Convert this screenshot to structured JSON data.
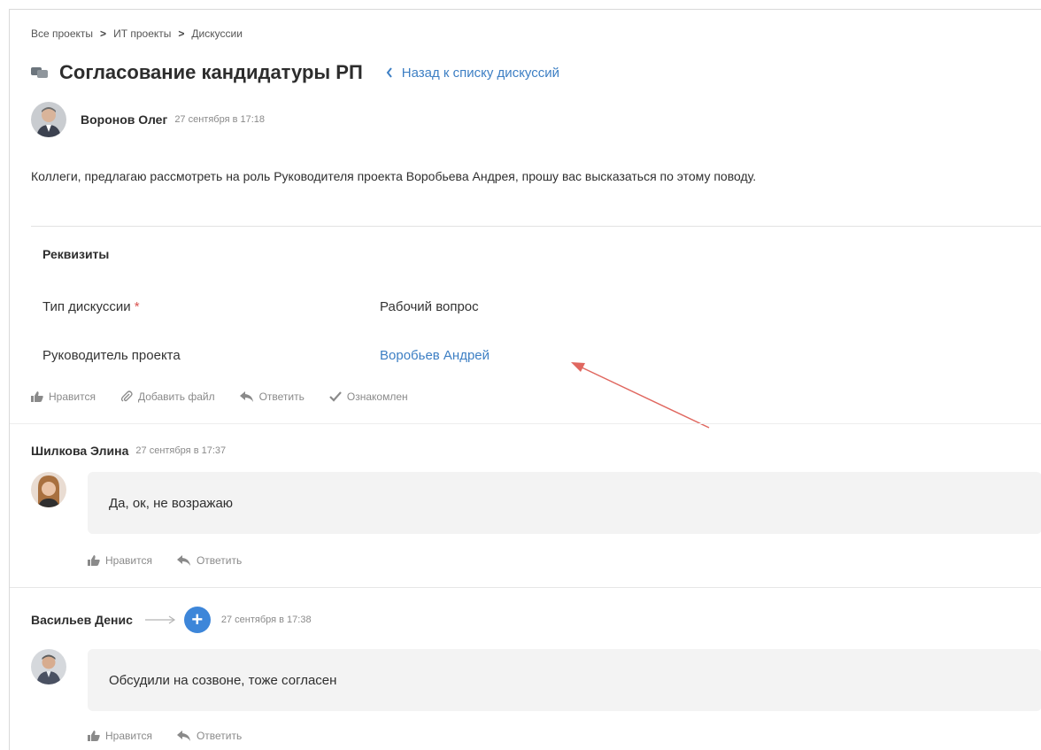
{
  "breadcrumb": {
    "items": [
      "Все проекты",
      "ИТ проекты",
      "Дискуссии"
    ],
    "separator": ">"
  },
  "header": {
    "title": "Согласование кандидатуры РП",
    "back_label": "Назад к списку дискуссий",
    "back_icon": "chevron-left-icon",
    "title_icon": "discussion-icon"
  },
  "post": {
    "author": "Воронов Олег",
    "date": "27 сентября в 17:18",
    "text": "Коллеги, предлагаю рассмотреть на роль Руководителя проекта Воробьева Андрея, прошу вас высказаться по этому поводу."
  },
  "requisites": {
    "title": "Реквизиты",
    "fields": [
      {
        "label": "Тип дискуссии",
        "required_mark": "*",
        "value": "Рабочий вопрос"
      },
      {
        "label": "Руководитель проекта",
        "value": "Воробьев Андрей"
      }
    ]
  },
  "post_actions": {
    "like": "Нравится",
    "attach": "Добавить файл",
    "reply": "Ответить",
    "acknowledged": "Ознакомлен"
  },
  "comments": [
    {
      "author": "Шилкова Элина",
      "date": "27 сентября в 17:37",
      "text": "Да, ок, не возражаю",
      "like": "Нравится",
      "reply": "Ответить"
    },
    {
      "author": "Васильев Денис",
      "date": "27 сентября в 17:38",
      "text": "Обсудили на созвоне, тоже согласен",
      "like": "Нравится",
      "reply": "Ответить",
      "add_icon": "+"
    }
  ],
  "colors": {
    "link": "#3d7fc4",
    "accent_blue": "#3d86d9",
    "annotation_arrow": "#e0675f",
    "bubble_bg": "#f3f3f3",
    "required": "#d9534f"
  }
}
